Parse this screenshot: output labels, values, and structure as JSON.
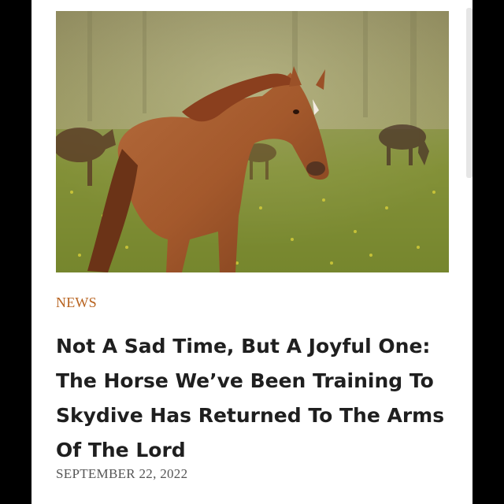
{
  "article": {
    "category": "NEWS",
    "headline": "Not A Sad Time, But A Joyful One: The Horse We’ve Been Training To Skydive Has Returned To The Arms Of The Lord",
    "date": "SEPTEMBER 22, 2022"
  },
  "colors": {
    "category_accent": "#b8631f",
    "headline_text": "#1f1f1f",
    "date_text": "#555555",
    "frame": "#000000"
  }
}
